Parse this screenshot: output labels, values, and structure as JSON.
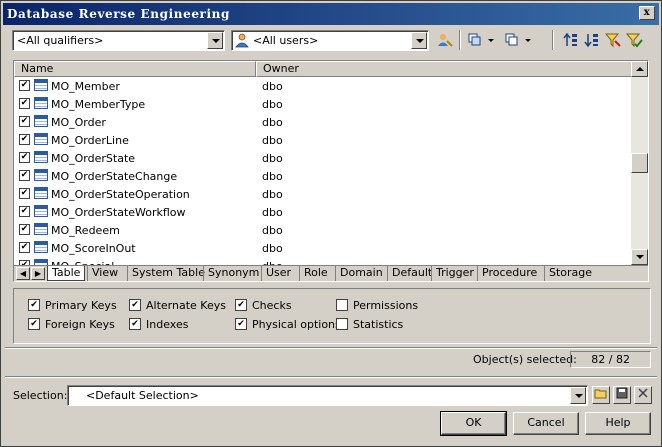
{
  "window": {
    "title": "Database Reverse Engineering",
    "close_label": "x"
  },
  "toolbar": {
    "qualifier_value": "<All qualifiers>",
    "users_value": "<All users>"
  },
  "list": {
    "columns": [
      "Name",
      "Owner"
    ],
    "rows": [
      {
        "name": "MO_Member",
        "owner": "dbo"
      },
      {
        "name": "MO_MemberType",
        "owner": "dbo"
      },
      {
        "name": "MO_Order",
        "owner": "dbo"
      },
      {
        "name": "MO_OrderLine",
        "owner": "dbo"
      },
      {
        "name": "MO_OrderState",
        "owner": "dbo"
      },
      {
        "name": "MO_OrderStateChange",
        "owner": "dbo"
      },
      {
        "name": "MO_OrderStateOperation",
        "owner": "dbo"
      },
      {
        "name": "MO_OrderStateWorkflow",
        "owner": "dbo"
      },
      {
        "name": "MO_Redeem",
        "owner": "dbo"
      },
      {
        "name": "MO_ScoreInOut",
        "owner": "dbo"
      },
      {
        "name": "MO_Special",
        "owner": "dbo"
      }
    ],
    "tabs": [
      "Table",
      "View",
      "System Table",
      "Synonym",
      "User",
      "Role",
      "Domain",
      "Default",
      "Trigger",
      "Procedure",
      "Storage"
    ],
    "active_tab": "Table"
  },
  "options": [
    {
      "label": "Primary Keys",
      "checked": true
    },
    {
      "label": "Alternate Keys",
      "checked": true
    },
    {
      "label": "Checks",
      "checked": true
    },
    {
      "label": "Permissions",
      "checked": false
    },
    {
      "label": "Foreign Keys",
      "checked": true
    },
    {
      "label": "Indexes",
      "checked": true
    },
    {
      "label": "Physical options",
      "checked": true
    },
    {
      "label": "Statistics",
      "checked": false
    }
  ],
  "status": {
    "selected_label": "Object(s) selected:",
    "selected_value": "82 / 82"
  },
  "selection": {
    "label": "Selection:",
    "value": "<Default Selection>"
  },
  "buttons": {
    "ok": "OK",
    "cancel": "Cancel",
    "help": "Help"
  }
}
